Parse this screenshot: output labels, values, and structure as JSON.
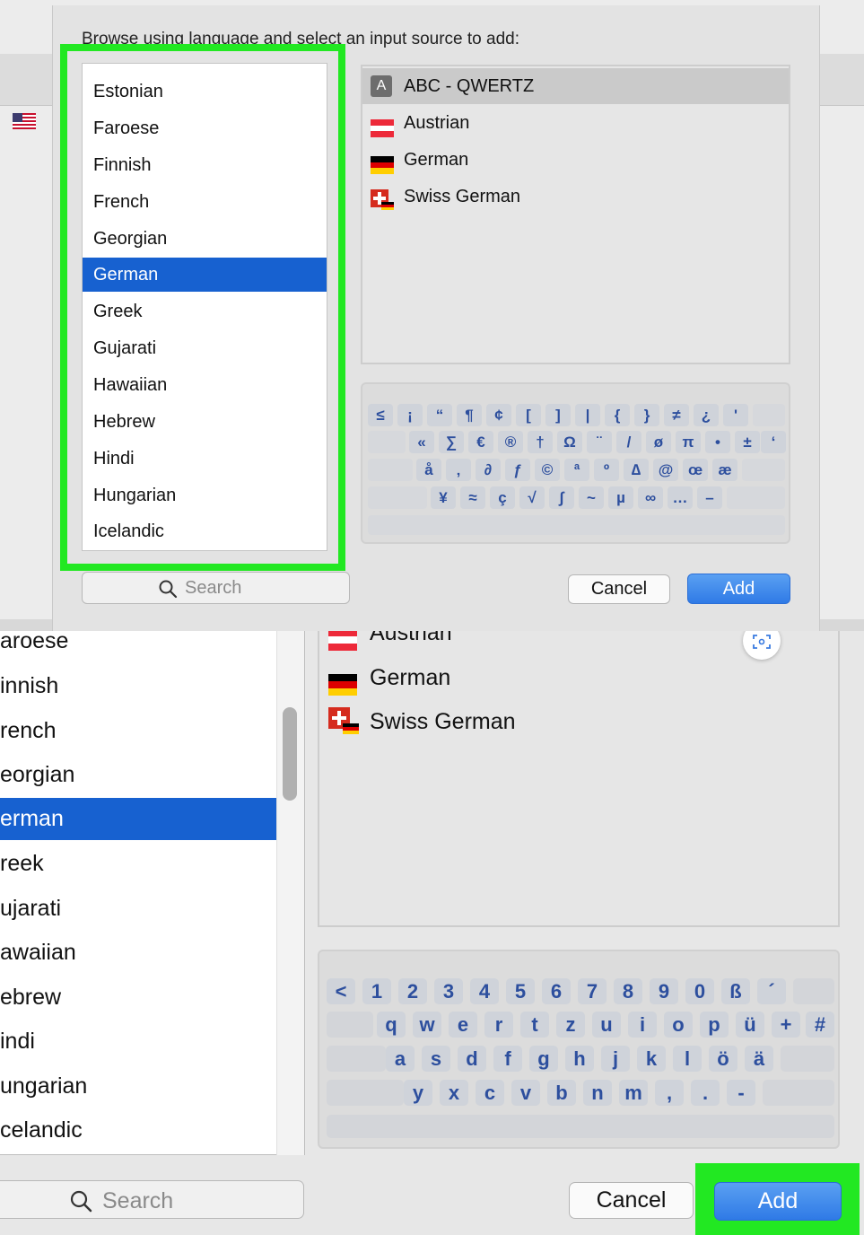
{
  "top": {
    "prompt": "Browse using language and select an input source to add:",
    "languages": [
      "Estonian",
      "Faroese",
      "Finnish",
      "French",
      "Georgian",
      "German",
      "Greek",
      "Gujarati",
      "Hawaiian",
      "Hebrew",
      "Hindi",
      "Hungarian",
      "Icelandic"
    ],
    "selected_language": "German",
    "sources": [
      {
        "label": "ABC - QWERTZ",
        "icon": "abc-icon",
        "selected": true
      },
      {
        "label": "Austrian",
        "icon": "austria-flag-icon",
        "selected": false
      },
      {
        "label": "German",
        "icon": "germany-flag-icon",
        "selected": false
      },
      {
        "label": "Swiss German",
        "icon": "switzerland-flag-icon",
        "selected": false
      }
    ],
    "keyboard_rows": [
      [
        "≤",
        "¡",
        "“",
        "¶",
        "¢",
        "[",
        "]",
        "|",
        "{",
        "}",
        "≠",
        "¿",
        "'"
      ],
      [
        "«",
        "∑",
        "€",
        "®",
        "†",
        "Ω",
        "¨",
        "/",
        "ø",
        "π",
        "•",
        "±",
        "‘"
      ],
      [
        "å",
        "‚",
        "∂",
        "ƒ",
        "©",
        "ª",
        "º",
        "∆",
        "@",
        "œ",
        "æ"
      ],
      [
        "¥",
        "≈",
        "ç",
        "√",
        "∫",
        "~",
        "µ",
        "∞",
        "…",
        "–"
      ]
    ],
    "search_placeholder": "Search",
    "cancel_label": "Cancel",
    "add_label": "Add",
    "highlight_color": "#22e822",
    "selection_color": "#1761d0"
  },
  "bottom": {
    "languages": [
      "aroese",
      "innish",
      "rench",
      "eorgian",
      "erman",
      "reek",
      "ujarati",
      "awaiian",
      "ebrew",
      "indi",
      "ungarian",
      "celandic"
    ],
    "selected_language": "erman",
    "partial_top_source": "Austrian",
    "sources": [
      {
        "label": "German",
        "icon": "germany-flag-icon"
      },
      {
        "label": "Swiss German",
        "icon": "switzerland-flag-icon"
      }
    ],
    "keyboard_rows": [
      [
        "<",
        "1",
        "2",
        "3",
        "4",
        "5",
        "6",
        "7",
        "8",
        "9",
        "0",
        "ß",
        "´"
      ],
      [
        "q",
        "w",
        "e",
        "r",
        "t",
        "z",
        "u",
        "i",
        "o",
        "p",
        "ü",
        "+",
        "#"
      ],
      [
        "a",
        "s",
        "d",
        "f",
        "g",
        "h",
        "j",
        "k",
        "l",
        "ö",
        "ä"
      ],
      [
        "y",
        "x",
        "c",
        "v",
        "b",
        "n",
        "m",
        ",",
        ".",
        "-"
      ]
    ],
    "search_placeholder": "Search",
    "cancel_label": "Cancel",
    "add_label": "Add"
  }
}
